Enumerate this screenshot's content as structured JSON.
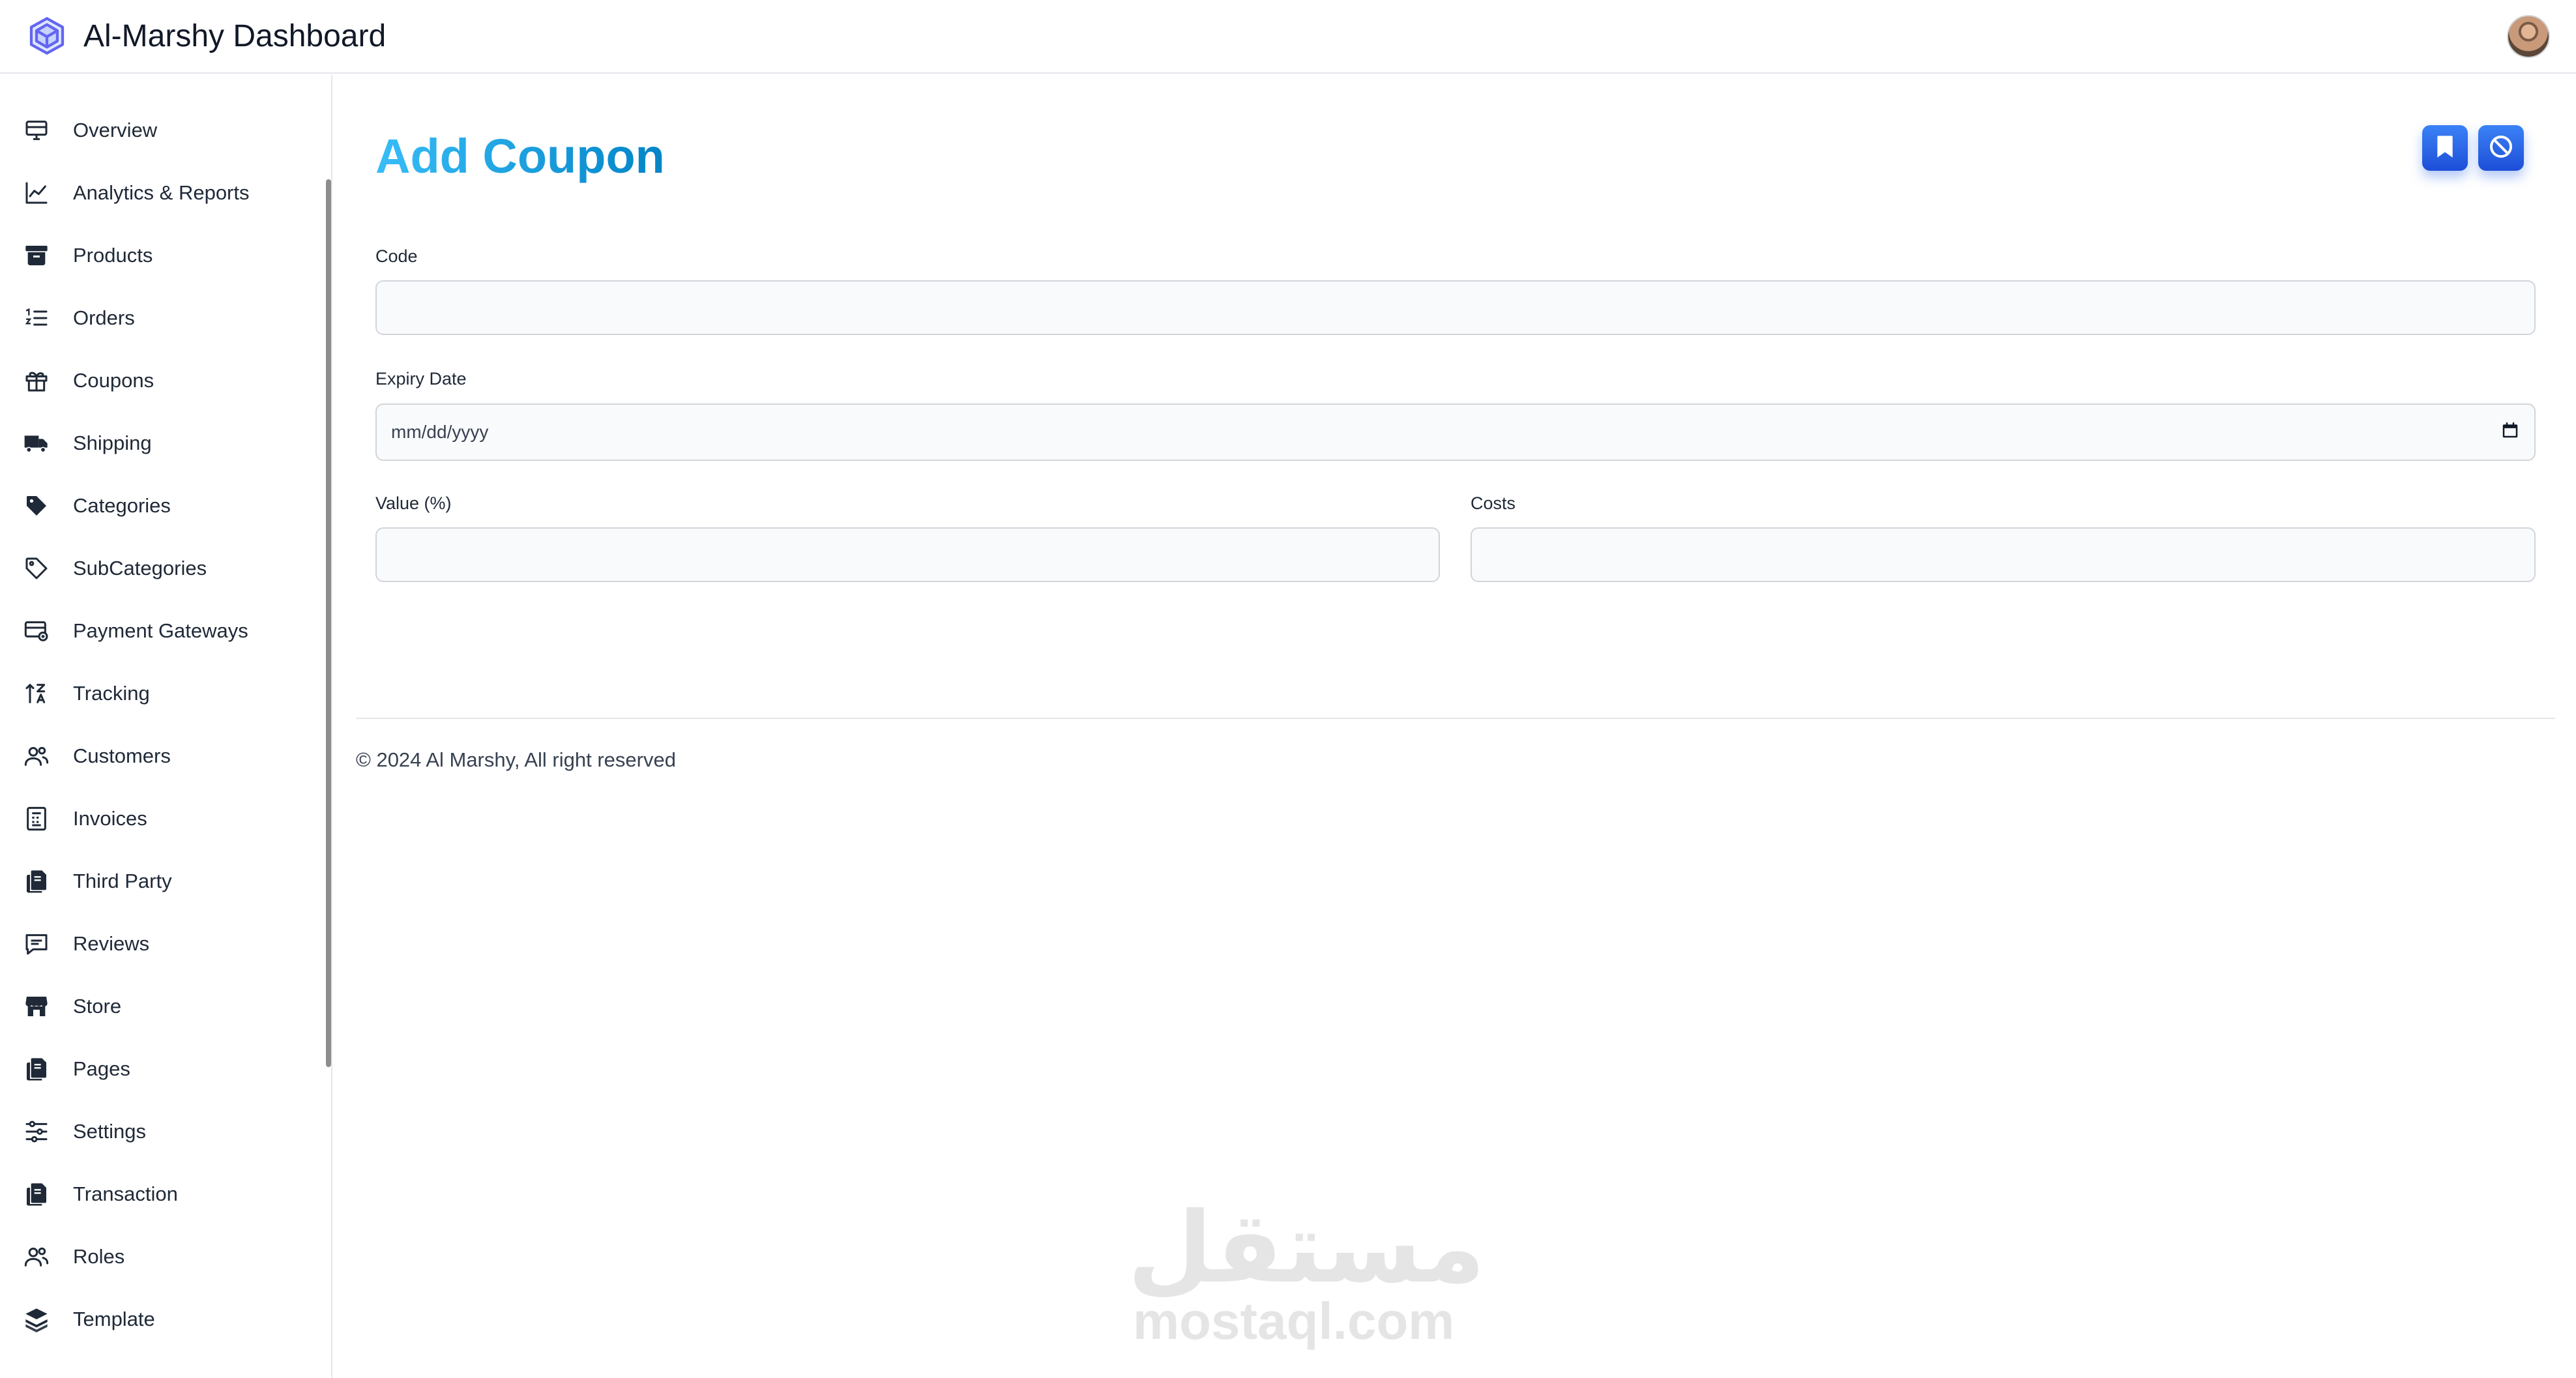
{
  "header": {
    "title": "Al-Marshy Dashboard",
    "logo_icon": "cube-icon",
    "avatar_icon": "user-avatar"
  },
  "sidebar": {
    "items": [
      {
        "label": "Overview",
        "icon": "monitor-icon"
      },
      {
        "label": "Analytics & Reports",
        "icon": "line-chart-icon"
      },
      {
        "label": "Products",
        "icon": "archive-box-icon"
      },
      {
        "label": "Orders",
        "icon": "numbered-list-icon"
      },
      {
        "label": "Coupons",
        "icon": "gift-icon"
      },
      {
        "label": "Shipping",
        "icon": "truck-icon"
      },
      {
        "label": "Categories",
        "icon": "tag-filled-icon"
      },
      {
        "label": "SubCategories",
        "icon": "tag-outline-icon"
      },
      {
        "label": "Payment Gateways",
        "icon": "credit-card-icon"
      },
      {
        "label": "Tracking",
        "icon": "sort-arrows-icon"
      },
      {
        "label": "Customers",
        "icon": "users-icon"
      },
      {
        "label": "Invoices",
        "icon": "receipt-icon"
      },
      {
        "label": "Third Party",
        "icon": "copy-docs-icon"
      },
      {
        "label": "Reviews",
        "icon": "chat-icon"
      },
      {
        "label": "Store",
        "icon": "storefront-icon"
      },
      {
        "label": "Pages",
        "icon": "copy-docs-icon"
      },
      {
        "label": "Settings",
        "icon": "sliders-icon"
      },
      {
        "label": "Transaction",
        "icon": "copy-docs-icon"
      },
      {
        "label": "Roles",
        "icon": "users-icon"
      },
      {
        "label": "Template",
        "icon": "layers-icon"
      }
    ]
  },
  "main": {
    "title": "Add Coupon",
    "actions": {
      "save_icon": "bookmark-icon",
      "cancel_icon": "ban-icon"
    },
    "form": {
      "code_label": "Code",
      "code_value": "",
      "expiry_label": "Expiry Date",
      "expiry_placeholder": "mm/dd/yyyy",
      "value_label": "Value (%)",
      "value_value": "",
      "costs_label": "Costs",
      "costs_value": ""
    },
    "footer": "© 2024 Al Marshy, All right reserved"
  },
  "watermark": {
    "arabic": "مستقل",
    "latin": "mostaql.com"
  },
  "colors": {
    "title_gradient_start": "#38bdf8",
    "title_gradient_end": "#0284c7",
    "button_blue": "#2563eb",
    "logo_purple": "#6366f1"
  }
}
